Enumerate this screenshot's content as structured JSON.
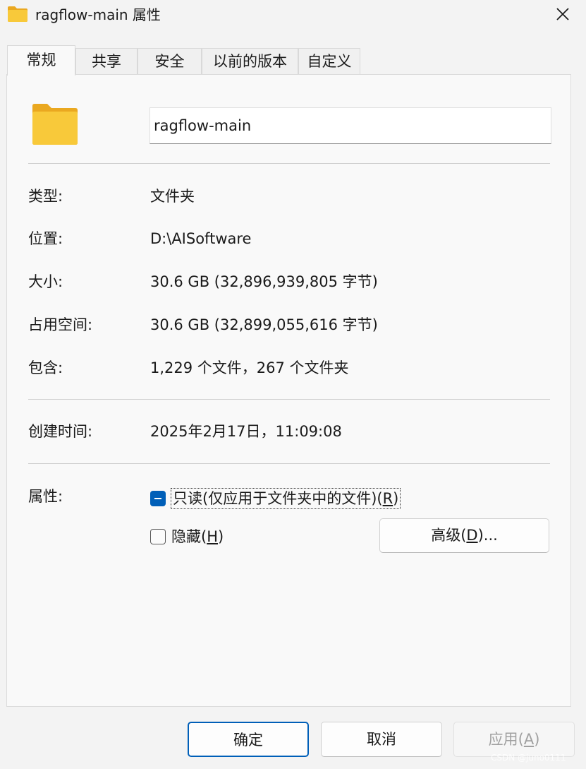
{
  "window": {
    "title": "ragflow-main 属性",
    "icon": "folder-icon",
    "close_icon": "close-icon"
  },
  "tabs": [
    {
      "label": "常规",
      "active": true
    },
    {
      "label": "共享",
      "active": false
    },
    {
      "label": "安全",
      "active": false
    },
    {
      "label": "以前的版本",
      "active": false
    },
    {
      "label": "自定义",
      "active": false
    }
  ],
  "general": {
    "folder_name": "ragflow-main",
    "type_label": "类型:",
    "type_value": "文件夹",
    "location_label": "位置:",
    "location_value": "D:\\AISoftware",
    "size_label": "大小:",
    "size_value": "30.6 GB (32,896,939,805 字节)",
    "size_on_disk_label": "占用空间:",
    "size_on_disk_value": "30.6 GB (32,899,055,616 字节)",
    "contains_label": "包含:",
    "contains_value": "1,229 个文件，267 个文件夹",
    "created_label": "创建时间:",
    "created_value": "2025年2月17日，11:09:08",
    "attributes_label": "属性:",
    "readonly_label": "只读(仅应用于文件夹中的文件)(",
    "readonly_key": "R",
    "readonly_suffix": ")",
    "readonly_state": "indeterminate",
    "hidden_label": "隐藏(",
    "hidden_key": "H",
    "hidden_suffix": ")",
    "hidden_checked": false,
    "advanced_label": "高级(",
    "advanced_key": "D",
    "advanced_suffix": ")..."
  },
  "footer": {
    "ok_label": "确定",
    "cancel_label": "取消",
    "apply_label": "应用(",
    "apply_key": "A",
    "apply_suffix": ")"
  },
  "watermark": "CSDN @juno0111",
  "colors": {
    "accent": "#005fb8",
    "folder_body": "#f8c93a",
    "folder_tab": "#eaa820"
  }
}
